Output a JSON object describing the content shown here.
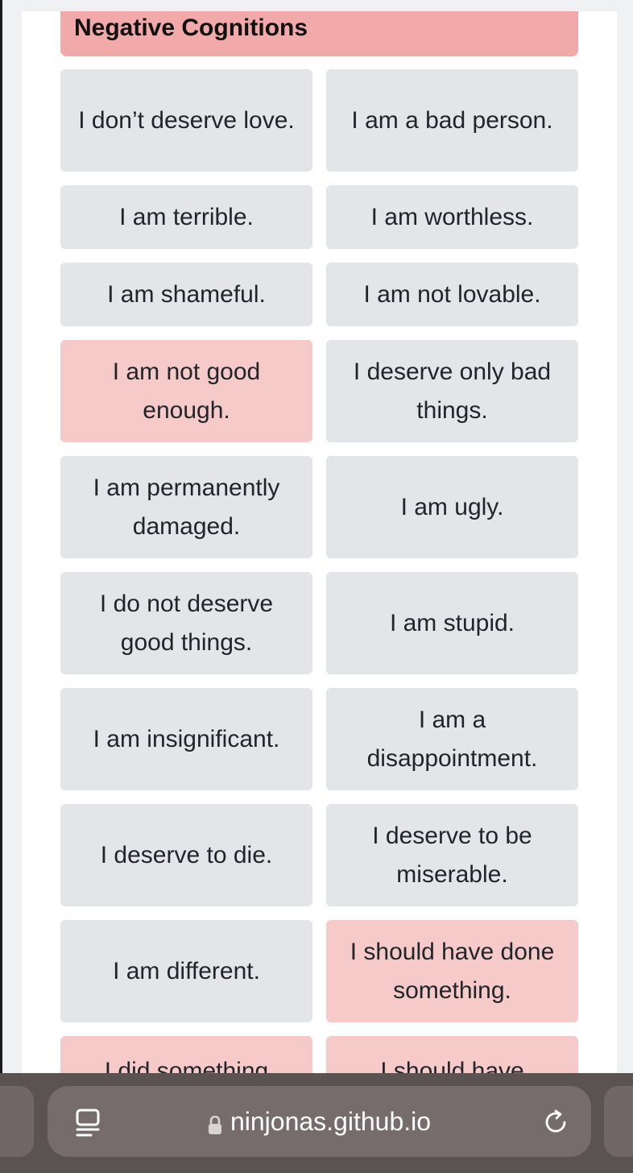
{
  "section": {
    "title": "Negative Cognitions"
  },
  "cognitions": [
    {
      "label": "I don’t deserve love.",
      "selected": false
    },
    {
      "label": "I am a bad person.",
      "selected": false
    },
    {
      "label": "I am terrible.",
      "selected": false
    },
    {
      "label": "I am worthless.",
      "selected": false
    },
    {
      "label": "I am shameful.",
      "selected": false
    },
    {
      "label": "I am not lovable.",
      "selected": false
    },
    {
      "label": "I am not good enough.",
      "selected": true
    },
    {
      "label": "I deserve only bad things.",
      "selected": false
    },
    {
      "label": "I am permanently damaged.",
      "selected": false
    },
    {
      "label": "I am ugly.",
      "selected": false
    },
    {
      "label": "I do not deserve good things.",
      "selected": false
    },
    {
      "label": "I am stupid.",
      "selected": false
    },
    {
      "label": "I am insignificant.",
      "selected": false
    },
    {
      "label": "I am a disappointment.",
      "selected": false
    },
    {
      "label": "I deserve to die.",
      "selected": false
    },
    {
      "label": "I deserve to be miserable.",
      "selected": false
    },
    {
      "label": "I am different.",
      "selected": false
    },
    {
      "label": "I should have done something.",
      "selected": true
    },
    {
      "label": "I did something",
      "selected": true
    },
    {
      "label": "I should have",
      "selected": true
    }
  ],
  "browser": {
    "url": "ninjonas.github.io"
  },
  "colors": {
    "header_bg": "#f2a9aa",
    "selected_bg": "#f7caca",
    "unselected_bg": "#e4e5e8"
  },
  "icons": {
    "reader": "reader-mode-icon",
    "lock": "lock-icon",
    "reload": "reload-icon"
  }
}
